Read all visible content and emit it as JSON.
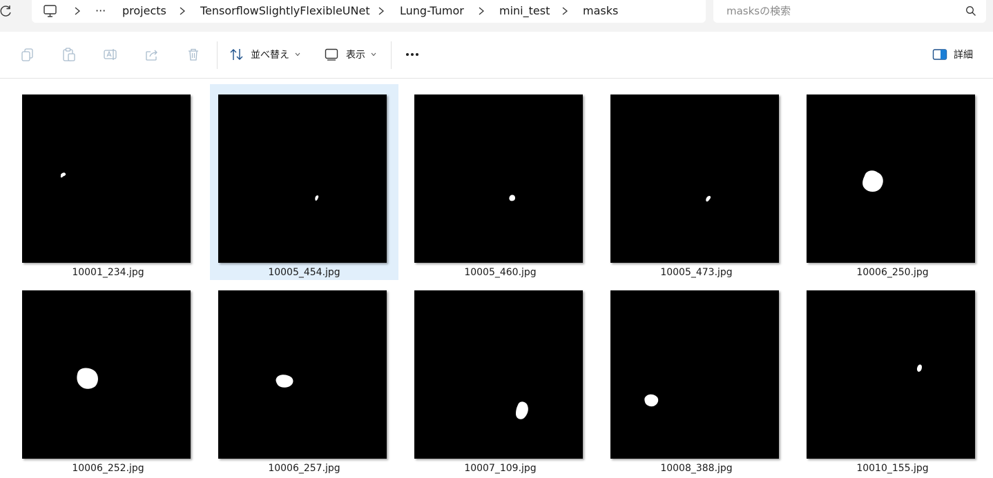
{
  "breadcrumb": {
    "ellipsis": "···",
    "items": [
      "projects",
      "TensorflowSlightlyFlexibleUNet",
      "Lung-Tumor",
      "mini_test",
      "masks"
    ]
  },
  "search": {
    "placeholder": "masksの検索"
  },
  "toolbar": {
    "sort_label": "並べ替え",
    "view_label": "表示",
    "details_label": "詳細"
  },
  "icons": {
    "refresh": "refresh-icon",
    "computer": "computer-icon",
    "copy": "copy-icon",
    "paste": "paste-icon",
    "rename": "rename-icon",
    "share": "share-icon",
    "delete": "delete-icon",
    "sort": "sort-icon",
    "view": "view-icon",
    "more": "more-icon",
    "details": "details-pane-icon",
    "search": "search-icon"
  },
  "colors": {
    "accent": "#0067c0",
    "selection": "#e1effb",
    "mask_bg": "#000000",
    "mask_fg": "#ffffff"
  },
  "files": [
    {
      "name": "10001_234.jpg",
      "selected": false
    },
    {
      "name": "10005_454.jpg",
      "selected": true
    },
    {
      "name": "10005_460.jpg",
      "selected": false
    },
    {
      "name": "10005_473.jpg",
      "selected": false
    },
    {
      "name": "10006_250.jpg",
      "selected": false
    },
    {
      "name": "10006_252.jpg",
      "selected": false
    },
    {
      "name": "10006_257.jpg",
      "selected": false
    },
    {
      "name": "10007_109.jpg",
      "selected": false
    },
    {
      "name": "10008_388.jpg",
      "selected": false
    },
    {
      "name": "10010_155.jpg",
      "selected": false
    }
  ]
}
